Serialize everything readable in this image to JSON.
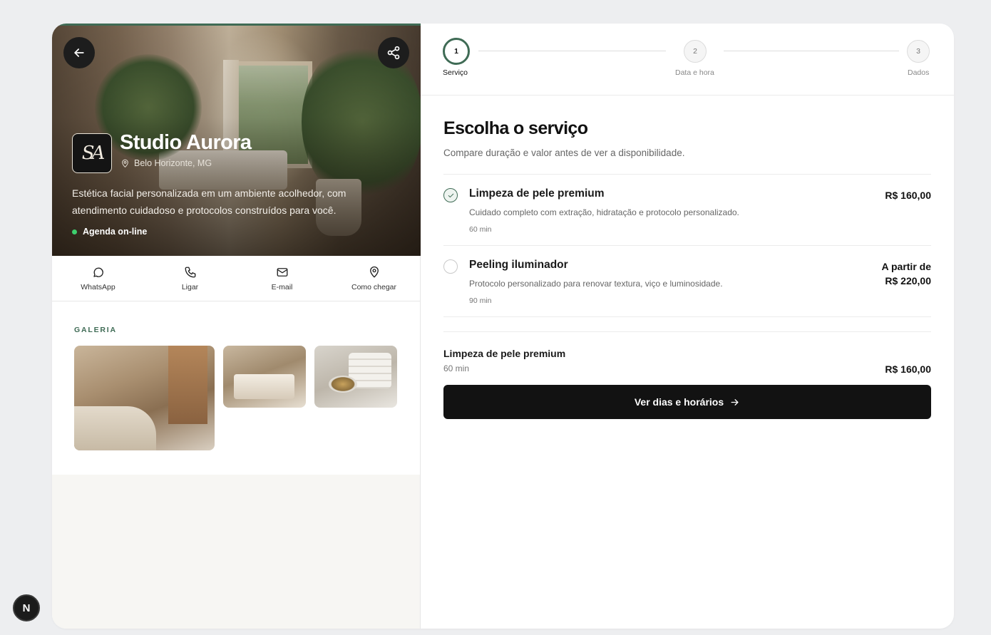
{
  "studio": {
    "name": "Studio Aurora",
    "logo_initials": "SA",
    "location": "Belo Horizonte, MG",
    "description": "Estética facial personalizada em um ambiente acolhedor, com atendimento cuidadoso e protocolos construídos para você.",
    "status": "Agenda on-line",
    "status_color": "#3ecf6e"
  },
  "hero_buttons": {
    "back_icon": "arrow-left-icon",
    "share_icon": "share-icon"
  },
  "actions": [
    {
      "label": "WhatsApp",
      "icon": "whatsapp-icon"
    },
    {
      "label": "Ligar",
      "icon": "phone-icon"
    },
    {
      "label": "E-mail",
      "icon": "mail-icon"
    },
    {
      "label": "Como chegar",
      "icon": "map-pin-icon"
    }
  ],
  "gallery": {
    "title": "GALERIA"
  },
  "stepper": {
    "steps": [
      {
        "number": "1",
        "label": "Serviço",
        "active": true
      },
      {
        "number": "2",
        "label": "Data e hora",
        "active": false
      },
      {
        "number": "3",
        "label": "Dados",
        "active": false
      }
    ]
  },
  "main": {
    "heading": "Escolha o serviço",
    "subheading": "Compare duração e valor antes de ver a disponibilidade.",
    "services": [
      {
        "name": "Limpeza de pele premium",
        "description": "Cuidado completo com extração, hidratação e protocolo personalizado.",
        "duration": "60 min",
        "price_prefix": "",
        "price": "R$ 160,00",
        "selected": true
      },
      {
        "name": "Peeling iluminador",
        "description": "Protocolo personalizado para renovar textura, viço e luminosidade.",
        "duration": "90 min",
        "price_prefix": "A partir de",
        "price": "R$ 220,00",
        "selected": false
      }
    ]
  },
  "summary": {
    "name": "Limpeza de pele premium",
    "duration": "60 min",
    "price": "R$ 160,00"
  },
  "cta": {
    "label": "Ver dias e horários"
  },
  "dev_badge": {
    "label": "N"
  },
  "colors": {
    "accent": "#3f6b55",
    "cta": "#121212",
    "background": "#edeef0"
  }
}
